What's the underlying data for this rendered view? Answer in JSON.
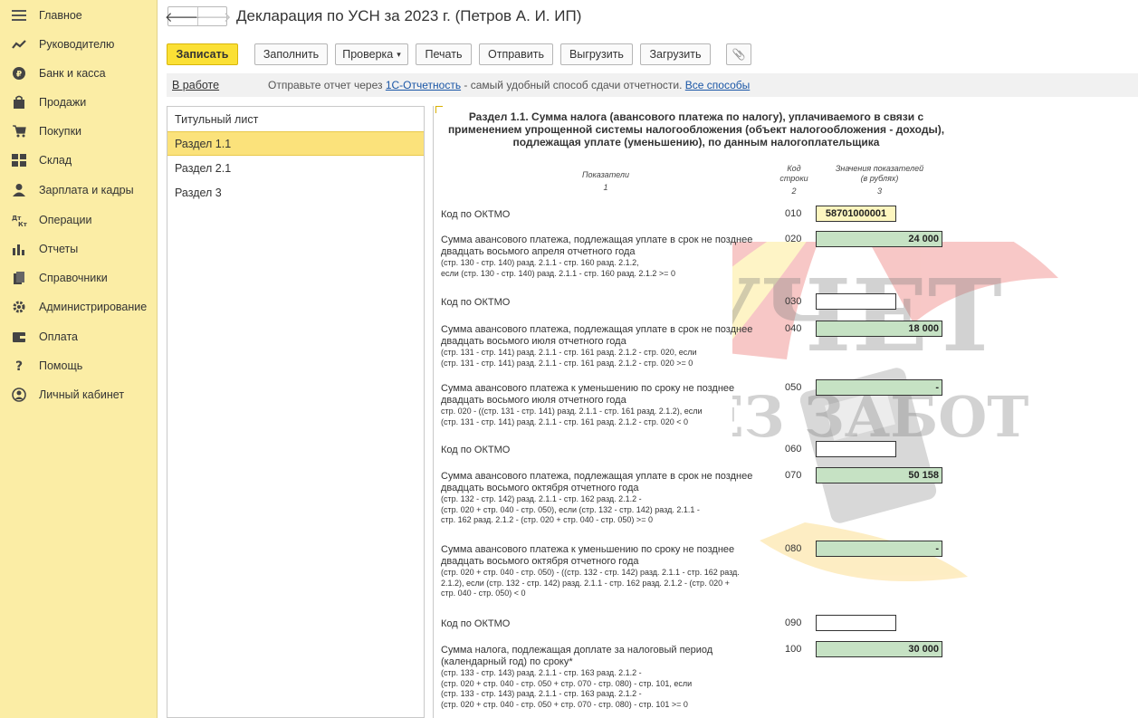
{
  "sidebar": {
    "items": [
      {
        "label": "Главное",
        "icon": "menu-icon"
      },
      {
        "label": "Руководителю",
        "icon": "trend-icon"
      },
      {
        "label": "Банк и касса",
        "icon": "ruble-icon"
      },
      {
        "label": "Продажи",
        "icon": "bag-icon"
      },
      {
        "label": "Покупки",
        "icon": "cart-icon"
      },
      {
        "label": "Склад",
        "icon": "grid-icon"
      },
      {
        "label": "Зарплата и кадры",
        "icon": "person-icon"
      },
      {
        "label": "Операции",
        "icon": "dt-kt-icon"
      },
      {
        "label": "Отчеты",
        "icon": "bar-chart-icon"
      },
      {
        "label": "Справочники",
        "icon": "books-icon"
      },
      {
        "label": "Администрирование",
        "icon": "gear-icon"
      },
      {
        "label": "Оплата",
        "icon": "wallet-icon"
      },
      {
        "label": "Помощь",
        "icon": "question-icon"
      },
      {
        "label": "Личный кабинет",
        "icon": "user-circle-icon"
      }
    ]
  },
  "header": {
    "title": "Декларация по УСН за 2023 г. (Петров А. И. ИП)",
    "back_glyph": "🡐",
    "forward_glyph": "🡒"
  },
  "toolbar": {
    "save": "Записать",
    "fill": "Заполнить",
    "check": "Проверка",
    "check_arrow": "▾",
    "print": "Печать",
    "send": "Отправить",
    "export": "Выгрузить",
    "import": "Загрузить",
    "attach_glyph": "📎"
  },
  "infobar": {
    "status": "В работе",
    "text_before": "Отправьте отчет через ",
    "service_link": "1С-Отчетность",
    "text_after": " - самый удобный способ сдачи отчетности. ",
    "all_link": "Все способы"
  },
  "sections": [
    {
      "label": "Титульный лист",
      "active": false
    },
    {
      "label": "Раздел 1.1",
      "active": true
    },
    {
      "label": "Раздел 2.1",
      "active": false
    },
    {
      "label": "Раздел 3",
      "active": false
    }
  ],
  "form": {
    "title": "Раздел 1.1. Сумма налога (авансового платежа по налогу), уплачиваемого в связи с применением упрощенной системы налогообложения (объект налогообложения - доходы), подлежащая уплате (уменьшению), по данным налогоплательщика",
    "columns": {
      "indicators": "Показатели",
      "indicators_num": "1",
      "code_line1": "Код",
      "code_line2": "строки",
      "code_num": "2",
      "values_line1": "Значения показателей",
      "values_line2": "(в рублях)",
      "values_num": "3"
    },
    "rows": [
      {
        "code": "010",
        "label": "Код по ОКТМО",
        "formula": "",
        "value": "58701000001",
        "style": "yellow"
      },
      {
        "code": "020",
        "label": "Сумма авансового платежа, подлежащая уплате в срок не позднее двадцать восьмого апреля отчетного года",
        "formula": "(стр. 130 - стр. 140) разд. 2.1.1 - стр. 160 разд. 2.1.2,\nесли (стр. 130 - стр. 140) разд. 2.1.1 - стр. 160 разд. 2.1.2 >= 0",
        "value": "24 000",
        "style": "green"
      },
      {
        "code": "030",
        "label": "Код по ОКТМО",
        "formula": "",
        "value": "",
        "style": "white"
      },
      {
        "code": "040",
        "label": "Сумма авансового платежа, подлежащая уплате в срок не позднее двадцать восьмого июля отчетного года",
        "formula": "(стр. 131 - стр. 141) разд. 2.1.1 - стр. 161 разд. 2.1.2 - стр. 020, если\n(стр. 131 - стр. 141) разд. 2.1.1 - стр. 161 разд. 2.1.2 - стр. 020 >= 0",
        "value": "18 000",
        "style": "green"
      },
      {
        "code": "050",
        "label": "Сумма авансового платежа к уменьшению по сроку не позднее двадцать восьмого июля отчетного года",
        "formula": "стр. 020 - ((стр. 131 - стр. 141) разд. 2.1.1 - стр. 161 разд. 2.1.2), если\n(стр. 131 - стр. 141) разд. 2.1.1 - стр. 161 разд. 2.1.2 - стр. 020 < 0",
        "value": "-",
        "style": "green"
      },
      {
        "code": "060",
        "label": "Код по ОКТМО",
        "formula": "",
        "value": "",
        "style": "white"
      },
      {
        "code": "070",
        "label": "Сумма авансового платежа, подлежащая уплате в срок не позднее двадцать восьмого октября отчетного года",
        "formula": "(стр. 132 - стр. 142) разд. 2.1.1 - стр. 162 разд. 2.1.2 -\n(стр. 020 + стр. 040 - стр. 050), если (стр. 132 - стр. 142) разд. 2.1.1 -\nстр. 162 разд. 2.1.2 - (стр. 020 + стр. 040 - стр. 050) >= 0",
        "value": "50 158",
        "style": "green"
      },
      {
        "code": "080",
        "label": "Сумма авансового платежа к уменьшению по сроку не позднее двадцать восьмого октября отчетного года",
        "formula": "(стр. 020 + стр. 040 - стр. 050) - ((стр. 132 - стр. 142) разд. 2.1.1 - стр. 162 разд.\n2.1.2), если (стр. 132 - стр. 142) разд. 2.1.1 - стр. 162 разд. 2.1.2 - (стр. 020 +\nстр. 040 - стр. 050) < 0",
        "value": "-",
        "style": "green"
      },
      {
        "code": "090",
        "label": "Код по ОКТМО",
        "formula": "",
        "value": "",
        "style": "white"
      },
      {
        "code": "100",
        "label": "Сумма налога, подлежащая доплате за налоговый период (календарный год) по сроку*",
        "formula": "(стр. 133 - стр. 143) разд. 2.1.1 - стр. 163 разд. 2.1.2 -\n(стр. 020 + стр. 040 - стр. 050 + стр. 070 - стр. 080) - стр. 101, если\n(стр. 133 - стр. 143) разд. 2.1.1 - стр. 163 разд. 2.1.2 -\n(стр. 020 + стр. 040 - стр. 050 + стр. 070 - стр. 080) - стр. 101 >= 0",
        "value": "30 000",
        "style": "green"
      }
    ]
  },
  "watermark": {
    "line1": "УЧЕТ",
    "line2": "БЕЗ ЗАБОТ"
  },
  "colors": {
    "sidebar_bg": "#fbeda5",
    "primary_button": "#fbe035",
    "active_section": "#fbe27b",
    "computed_field": "#c6e2c4",
    "input_field": "#fdf6bf",
    "link": "#1a56a6"
  }
}
